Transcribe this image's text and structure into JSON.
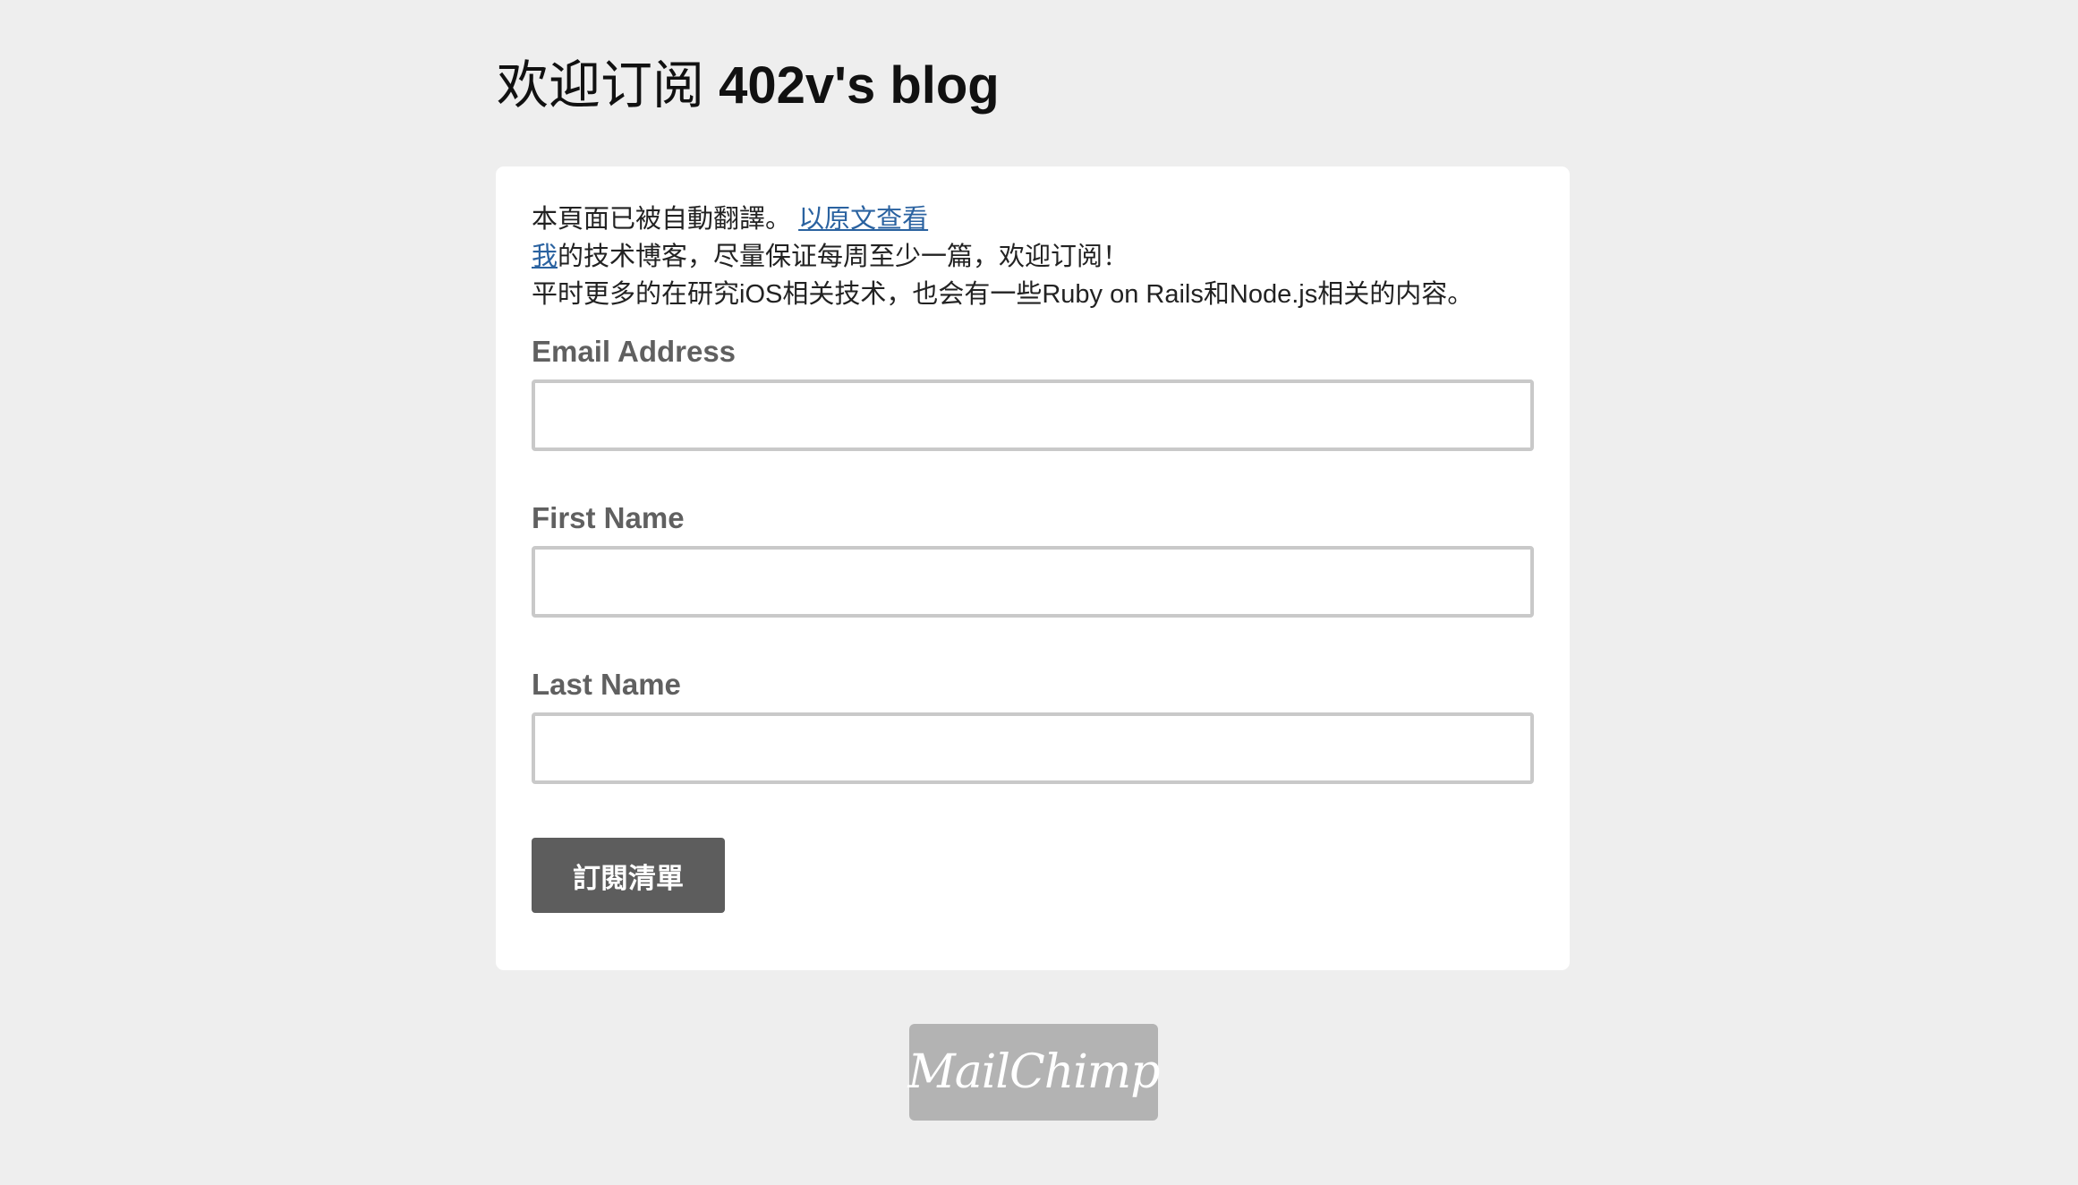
{
  "header": {
    "title_zh": "欢迎订阅",
    "title_en": "402v's blog"
  },
  "intro": {
    "translation_notice": "本頁面已被自動翻譯。",
    "view_original_link": "以原文查看",
    "line2_link": "我",
    "line2_rest": "的技术博客，尽量保证每周至少一篇，欢迎订阅！",
    "line3": "平时更多的在研究iOS相关技术，也会有一些Ruby on Rails和Node.js相关的内容。"
  },
  "form": {
    "email": {
      "label": "Email Address",
      "value": ""
    },
    "first_name": {
      "label": "First Name",
      "value": ""
    },
    "last_name": {
      "label": "Last Name",
      "value": ""
    },
    "submit_label": "訂閱清單"
  },
  "footer": {
    "badge_text": "MailChimp"
  },
  "colors": {
    "background": "#eeeeee",
    "card": "#ffffff",
    "link": "#2a62a0",
    "label": "#606060",
    "button": "#5d5d5d",
    "badge": "#b3b3b3"
  }
}
